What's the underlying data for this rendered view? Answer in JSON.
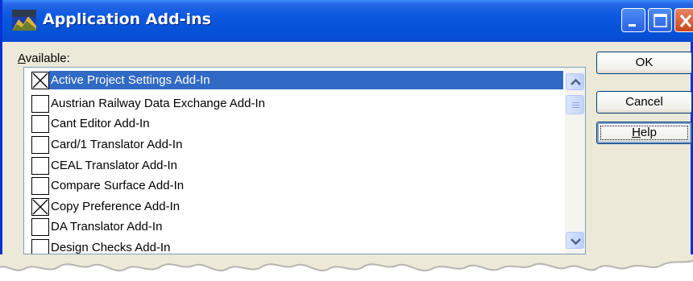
{
  "window": {
    "title": "Application Add-ins"
  },
  "list": {
    "label_first": "A",
    "label_rest": "vailable:",
    "items": [
      {
        "label": "Active Project Settings Add-In",
        "checked": true,
        "selected": true
      },
      {
        "label": "Austrian Railway Data Exchange Add-In",
        "checked": false,
        "selected": false
      },
      {
        "label": "Cant Editor Add-In",
        "checked": false,
        "selected": false
      },
      {
        "label": "Card/1 Translator Add-In",
        "checked": false,
        "selected": false
      },
      {
        "label": "CEAL Translator Add-In",
        "checked": false,
        "selected": false
      },
      {
        "label": "Compare Surface Add-In",
        "checked": false,
        "selected": false
      },
      {
        "label": "Copy Preference Add-In",
        "checked": true,
        "selected": false
      },
      {
        "label": "DA Translator Add-In",
        "checked": false,
        "selected": false
      },
      {
        "label": "Design Checks Add-In",
        "checked": false,
        "selected": false
      }
    ]
  },
  "buttons": {
    "ok": "OK",
    "cancel": "Cancel",
    "help_first": "H",
    "help_rest": "elp"
  },
  "colors": {
    "selection": "#316ac5",
    "titlebar": "#0653d8",
    "dialog_bg": "#ece9d8"
  },
  "icons": {
    "app": "app-icon",
    "minimize": "minimize-icon",
    "maximize": "maximize-icon",
    "close": "close-icon",
    "scroll_up": "chevron-up-icon",
    "scroll_down": "chevron-down-icon",
    "checkmark": "x-mark-icon"
  }
}
